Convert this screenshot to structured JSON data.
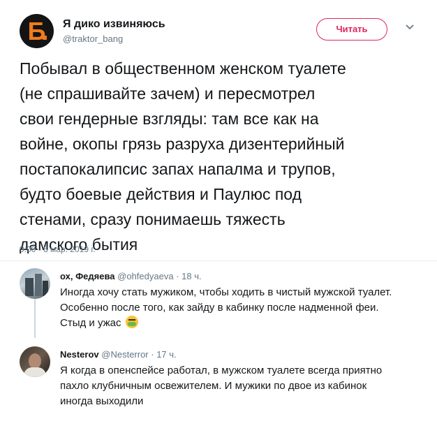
{
  "tweet": {
    "avatar_letter": "Б",
    "display_name": "Я дико извиняюсь",
    "handle": "@traktor_bang",
    "follow_label": "Читать",
    "text": "Побывал в общественном женском туалете\n(не спрашивайте зачем) и пересмотрел\nсвои гендерные взгляды: там все как на\nвойне, окопы грязь разруха дизентерийный\nпостапокалипсис запах напалма и трупов,\nбудто боевые действия и Паулюс под\nстенами, сразу понимаешь тяжесть\nдамского бытия",
    "timestamp": "9:00 - 6 мар. 2019 г."
  },
  "replies": [
    {
      "name": "ох, Федяева",
      "handle": "@ohfedyaeva",
      "time": "· 18 ч.",
      "text": "Иногда хочу стать мужиком, чтобы ходить в чистый мужской туалет.\nОсобенно после того, как зайду в кабинку после надменной феи.\nСтыд и ужас",
      "avatar_icon": "city-buildings-photo"
    },
    {
      "name": "Nesterov",
      "handle": "@Nesterror",
      "time": "· 17 ч.",
      "text": "Я когда в опенспейсе работал, в мужском туалете всегда приятно\nпахло клубничным освежителем. И мужики по двое из кабинок\nиногда выходили",
      "avatar_icon": "man-portrait-photo"
    }
  ],
  "colors": {
    "accent": "#e0245e",
    "brand_orange": "#f07b1c",
    "secondary_text": "#657786",
    "divider": "#e6ecf0"
  }
}
